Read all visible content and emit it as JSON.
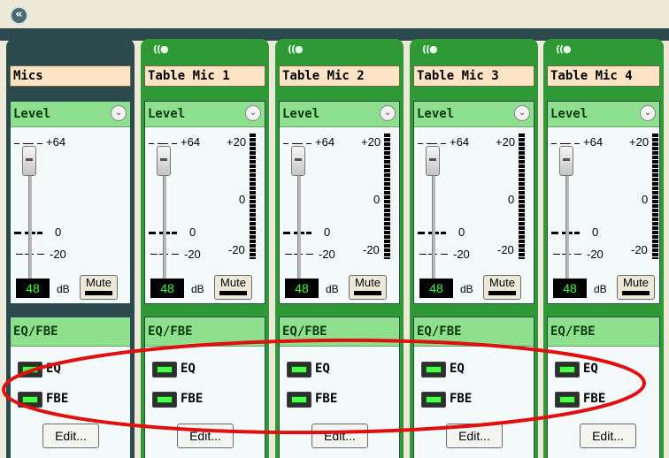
{
  "collapse_icon": "double-chevron-left-icon",
  "channels": [
    {
      "name": "Mics",
      "has_meter": false,
      "gain": "48",
      "level_title": "Level",
      "eq_title": "EQ/FBE"
    },
    {
      "name": "Table Mic 1",
      "has_meter": true,
      "gain": "48",
      "level_title": "Level",
      "eq_title": "EQ/FBE"
    },
    {
      "name": "Table Mic 2",
      "has_meter": true,
      "gain": "48",
      "level_title": "Level",
      "eq_title": "EQ/FBE"
    },
    {
      "name": "Table Mic 3",
      "has_meter": true,
      "gain": "48",
      "level_title": "Level",
      "eq_title": "EQ/FBE"
    },
    {
      "name": "Table Mic 4",
      "has_meter": true,
      "gain": "48",
      "level_title": "Level",
      "eq_title": "EQ/FBE"
    }
  ],
  "labels": {
    "fader_top": "+64",
    "fader_mid": "0",
    "fader_bottom": "-20",
    "meter_top": "+20",
    "meter_mid": "0",
    "meter_bottom": "-20",
    "db": "dB",
    "mute": "Mute",
    "eq": "EQ",
    "fbe": "FBE",
    "edit": "Edit...",
    "mic_glyph": "((●"
  },
  "colors": {
    "strip_green": "#2f9a35",
    "strip_dark": "#2c4a4e",
    "header_green": "#8ee08e",
    "led_on": "#4cff4c",
    "annotation": "#e01010"
  }
}
